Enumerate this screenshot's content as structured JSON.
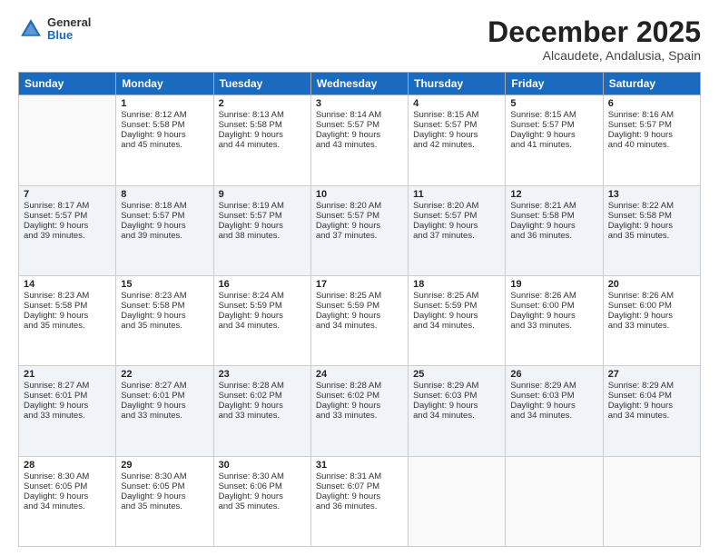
{
  "header": {
    "logo": {
      "general": "General",
      "blue": "Blue"
    },
    "title": "December 2025",
    "location": "Alcaudete, Andalusia, Spain"
  },
  "weekdays": [
    "Sunday",
    "Monday",
    "Tuesday",
    "Wednesday",
    "Thursday",
    "Friday",
    "Saturday"
  ],
  "weeks": [
    [
      {
        "day": "",
        "lines": []
      },
      {
        "day": "1",
        "lines": [
          "Sunrise: 8:12 AM",
          "Sunset: 5:58 PM",
          "Daylight: 9 hours",
          "and 45 minutes."
        ]
      },
      {
        "day": "2",
        "lines": [
          "Sunrise: 8:13 AM",
          "Sunset: 5:58 PM",
          "Daylight: 9 hours",
          "and 44 minutes."
        ]
      },
      {
        "day": "3",
        "lines": [
          "Sunrise: 8:14 AM",
          "Sunset: 5:57 PM",
          "Daylight: 9 hours",
          "and 43 minutes."
        ]
      },
      {
        "day": "4",
        "lines": [
          "Sunrise: 8:15 AM",
          "Sunset: 5:57 PM",
          "Daylight: 9 hours",
          "and 42 minutes."
        ]
      },
      {
        "day": "5",
        "lines": [
          "Sunrise: 8:15 AM",
          "Sunset: 5:57 PM",
          "Daylight: 9 hours",
          "and 41 minutes."
        ]
      },
      {
        "day": "6",
        "lines": [
          "Sunrise: 8:16 AM",
          "Sunset: 5:57 PM",
          "Daylight: 9 hours",
          "and 40 minutes."
        ]
      }
    ],
    [
      {
        "day": "7",
        "lines": [
          "Sunrise: 8:17 AM",
          "Sunset: 5:57 PM",
          "Daylight: 9 hours",
          "and 39 minutes."
        ]
      },
      {
        "day": "8",
        "lines": [
          "Sunrise: 8:18 AM",
          "Sunset: 5:57 PM",
          "Daylight: 9 hours",
          "and 39 minutes."
        ]
      },
      {
        "day": "9",
        "lines": [
          "Sunrise: 8:19 AM",
          "Sunset: 5:57 PM",
          "Daylight: 9 hours",
          "and 38 minutes."
        ]
      },
      {
        "day": "10",
        "lines": [
          "Sunrise: 8:20 AM",
          "Sunset: 5:57 PM",
          "Daylight: 9 hours",
          "and 37 minutes."
        ]
      },
      {
        "day": "11",
        "lines": [
          "Sunrise: 8:20 AM",
          "Sunset: 5:57 PM",
          "Daylight: 9 hours",
          "and 37 minutes."
        ]
      },
      {
        "day": "12",
        "lines": [
          "Sunrise: 8:21 AM",
          "Sunset: 5:58 PM",
          "Daylight: 9 hours",
          "and 36 minutes."
        ]
      },
      {
        "day": "13",
        "lines": [
          "Sunrise: 8:22 AM",
          "Sunset: 5:58 PM",
          "Daylight: 9 hours",
          "and 35 minutes."
        ]
      }
    ],
    [
      {
        "day": "14",
        "lines": [
          "Sunrise: 8:23 AM",
          "Sunset: 5:58 PM",
          "Daylight: 9 hours",
          "and 35 minutes."
        ]
      },
      {
        "day": "15",
        "lines": [
          "Sunrise: 8:23 AM",
          "Sunset: 5:58 PM",
          "Daylight: 9 hours",
          "and 35 minutes."
        ]
      },
      {
        "day": "16",
        "lines": [
          "Sunrise: 8:24 AM",
          "Sunset: 5:59 PM",
          "Daylight: 9 hours",
          "and 34 minutes."
        ]
      },
      {
        "day": "17",
        "lines": [
          "Sunrise: 8:25 AM",
          "Sunset: 5:59 PM",
          "Daylight: 9 hours",
          "and 34 minutes."
        ]
      },
      {
        "day": "18",
        "lines": [
          "Sunrise: 8:25 AM",
          "Sunset: 5:59 PM",
          "Daylight: 9 hours",
          "and 34 minutes."
        ]
      },
      {
        "day": "19",
        "lines": [
          "Sunrise: 8:26 AM",
          "Sunset: 6:00 PM",
          "Daylight: 9 hours",
          "and 33 minutes."
        ]
      },
      {
        "day": "20",
        "lines": [
          "Sunrise: 8:26 AM",
          "Sunset: 6:00 PM",
          "Daylight: 9 hours",
          "and 33 minutes."
        ]
      }
    ],
    [
      {
        "day": "21",
        "lines": [
          "Sunrise: 8:27 AM",
          "Sunset: 6:01 PM",
          "Daylight: 9 hours",
          "and 33 minutes."
        ]
      },
      {
        "day": "22",
        "lines": [
          "Sunrise: 8:27 AM",
          "Sunset: 6:01 PM",
          "Daylight: 9 hours",
          "and 33 minutes."
        ]
      },
      {
        "day": "23",
        "lines": [
          "Sunrise: 8:28 AM",
          "Sunset: 6:02 PM",
          "Daylight: 9 hours",
          "and 33 minutes."
        ]
      },
      {
        "day": "24",
        "lines": [
          "Sunrise: 8:28 AM",
          "Sunset: 6:02 PM",
          "Daylight: 9 hours",
          "and 33 minutes."
        ]
      },
      {
        "day": "25",
        "lines": [
          "Sunrise: 8:29 AM",
          "Sunset: 6:03 PM",
          "Daylight: 9 hours",
          "and 34 minutes."
        ]
      },
      {
        "day": "26",
        "lines": [
          "Sunrise: 8:29 AM",
          "Sunset: 6:03 PM",
          "Daylight: 9 hours",
          "and 34 minutes."
        ]
      },
      {
        "day": "27",
        "lines": [
          "Sunrise: 8:29 AM",
          "Sunset: 6:04 PM",
          "Daylight: 9 hours",
          "and 34 minutes."
        ]
      }
    ],
    [
      {
        "day": "28",
        "lines": [
          "Sunrise: 8:30 AM",
          "Sunset: 6:05 PM",
          "Daylight: 9 hours",
          "and 34 minutes."
        ]
      },
      {
        "day": "29",
        "lines": [
          "Sunrise: 8:30 AM",
          "Sunset: 6:05 PM",
          "Daylight: 9 hours",
          "and 35 minutes."
        ]
      },
      {
        "day": "30",
        "lines": [
          "Sunrise: 8:30 AM",
          "Sunset: 6:06 PM",
          "Daylight: 9 hours",
          "and 35 minutes."
        ]
      },
      {
        "day": "31",
        "lines": [
          "Sunrise: 8:31 AM",
          "Sunset: 6:07 PM",
          "Daylight: 9 hours",
          "and 36 minutes."
        ]
      },
      {
        "day": "",
        "lines": []
      },
      {
        "day": "",
        "lines": []
      },
      {
        "day": "",
        "lines": []
      }
    ]
  ]
}
